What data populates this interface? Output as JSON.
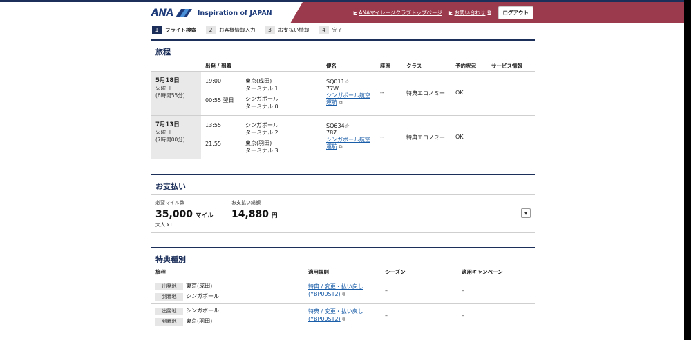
{
  "header": {
    "logo_ana": "ANA",
    "logo_tagline": "Inspiration of JAPAN",
    "link_mileage": "ANAマイレージクラブトップページ",
    "link_contact": "お問い合わせ",
    "logout": "ログアウト"
  },
  "steps": [
    {
      "num": "1",
      "label": "フライト検索"
    },
    {
      "num": "2",
      "label": "お客様情報入力"
    },
    {
      "num": "3",
      "label": "お支払い情報"
    },
    {
      "num": "4",
      "label": "完了"
    }
  ],
  "itinerary": {
    "title": "旅程",
    "columns": {
      "dep_arr": "出発 / 到着",
      "flight": "便名",
      "seat": "座席",
      "class": "クラス",
      "status": "予約状況",
      "service": "サービス情報"
    },
    "rows": [
      {
        "date": "5月18日",
        "weekday": "火曜日",
        "duration": "(6時間55分)",
        "dep_time": "19:00",
        "dep_city": "東京(成田)",
        "dep_terminal": "ターミナル 1",
        "arr_time": "00:55 翌日",
        "arr_city": "シンガポール",
        "arr_terminal": "ターミナル 0",
        "flight_no": "SQ011☆",
        "aircraft": "77W",
        "operator_line1": "シンガポール航空",
        "operator_line2": "運航",
        "seat": "--",
        "class": "特典エコノミー",
        "status": "OK"
      },
      {
        "date": "7月13日",
        "weekday": "火曜日",
        "duration": "(7時間00分)",
        "dep_time": "13:55",
        "dep_city": "シンガポール",
        "dep_terminal": "ターミナル 2",
        "arr_time": "21:55",
        "arr_city": "東京(羽田)",
        "arr_terminal": "ターミナル 3",
        "flight_no": "SQ634☆",
        "aircraft": "787",
        "operator_line1": "シンガポール航空",
        "operator_line2": "運航",
        "seat": "--",
        "class": "特典エコノミー",
        "status": "OK"
      }
    ]
  },
  "payment": {
    "title": "お支払い",
    "miles_label": "必要マイル数",
    "miles_value": "35,000",
    "miles_unit": "マイル",
    "miles_sub": "大人 x1",
    "total_label": "お支払い総額",
    "total_value": "14,880",
    "total_unit": "円"
  },
  "award": {
    "title": "特典種別",
    "columns": {
      "itinerary": "旅程",
      "rules": "適用規則",
      "season": "シーズン",
      "campaign": "適用キャンペーン"
    },
    "rows": [
      {
        "dep_tag": "出発地",
        "dep_city": "東京(成田)",
        "arr_tag": "到着地",
        "arr_city": "シンガポール",
        "rule_line1": "特典 / 変更・払い戻し",
        "rule_line2": "(YBP00ST2)",
        "season": "–",
        "campaign": "–"
      },
      {
        "dep_tag": "出発地",
        "dep_city": "シンガポール",
        "arr_tag": "到着地",
        "arr_city": "東京(羽田)",
        "rule_line1": "特典 / 変更・払い戻し",
        "rule_line2": "(YBP00ST2)",
        "season": "–",
        "campaign": "–"
      }
    ]
  },
  "colors": {
    "brand_navy": "#1c2f5a",
    "header_red": "#9b3a4c",
    "link_blue": "#1a5da8"
  }
}
